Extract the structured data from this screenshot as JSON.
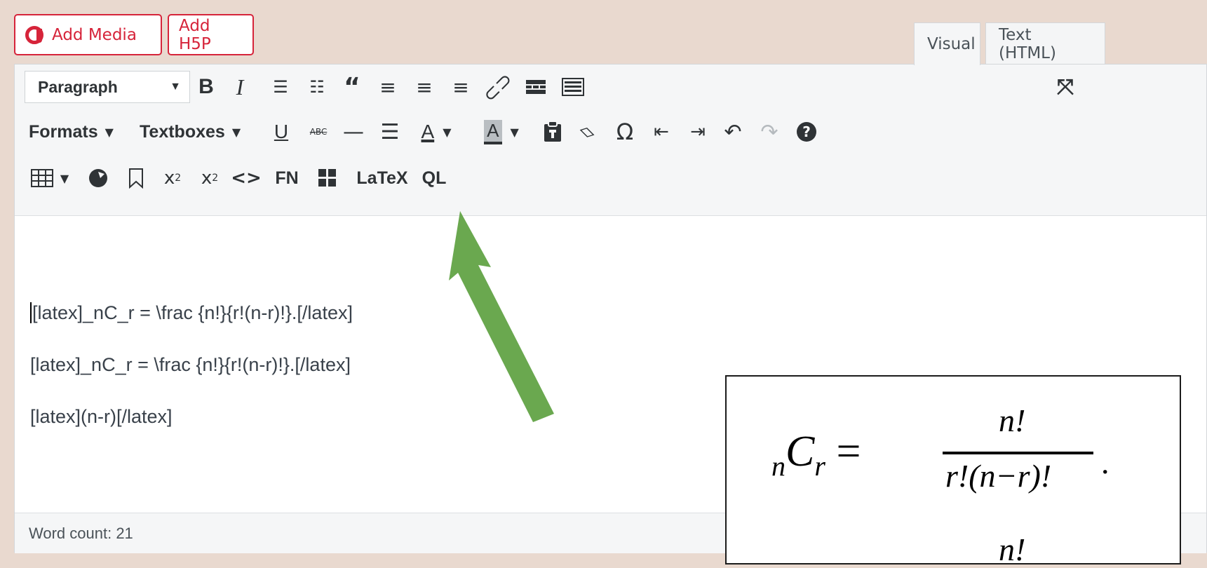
{
  "media_buttons": {
    "add_media": "Add Media",
    "add_h5p": "Add H5P"
  },
  "tabs": {
    "visual": "Visual",
    "text": "Text (HTML)"
  },
  "toolbar": {
    "paragraph_select": "Paragraph",
    "formats": "Formats",
    "textboxes": "Textboxes",
    "fn": "FN",
    "latex": "LaTeX",
    "ql": "QL"
  },
  "content": {
    "lines": [
      "[latex]_nC_r = \\frac {n!}{r!(n-r)!}.[/latex]",
      "[latex]_nC_r = \\frac {n!}{r!(n-r)!}.[/latex]",
      "[latex](n-r)[/latex]"
    ]
  },
  "status": {
    "word_count": "Word count: 21"
  },
  "formula": {
    "lhs": "nCr =",
    "numerator": "n!",
    "denominator": "r!(n−r)!",
    "dot": ".",
    "numerator_2": "n!"
  },
  "colors": {
    "accent": "#d6243a",
    "arrow": "#6aa84f",
    "background": "#e9d9cf"
  },
  "icons": [
    "bold-icon",
    "italic-icon",
    "bullet-list-icon",
    "numbered-list-icon",
    "blockquote-icon",
    "align-left-icon",
    "align-center-icon",
    "align-right-icon",
    "link-icon",
    "read-more-icon",
    "toolbar-toggle-icon",
    "fullscreen-icon",
    "underline-icon",
    "strikethrough-icon",
    "horizontal-line-icon",
    "justify-icon",
    "text-color-icon",
    "background-color-icon",
    "paste-text-icon",
    "clear-formatting-icon",
    "special-character-icon",
    "outdent-icon",
    "indent-icon",
    "undo-icon",
    "redo-icon",
    "help-icon",
    "table-icon",
    "h5p-icon",
    "bookmark-icon",
    "superscript-icon",
    "subscript-icon",
    "code-icon",
    "glossary-icon"
  ]
}
